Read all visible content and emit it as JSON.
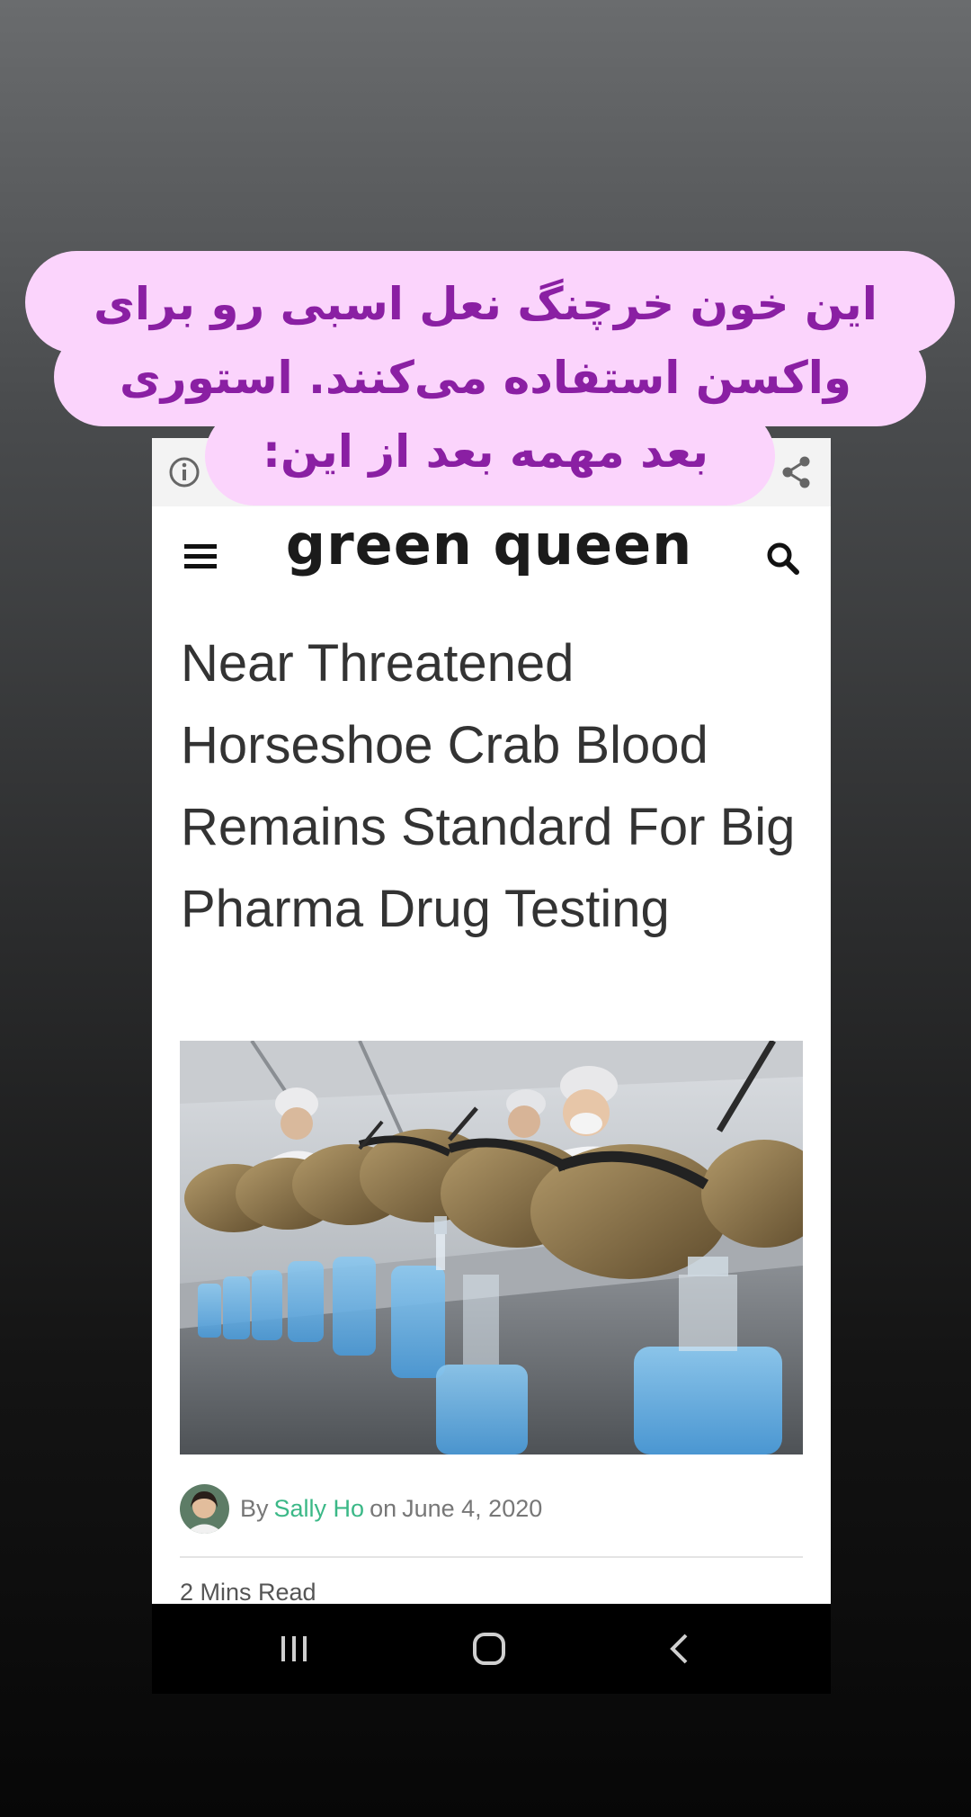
{
  "story_caption": {
    "lines": [
      "این خون خرچنگ نعل اسبی رو برای",
      "واکسن استفاده می‌کنند. استوری",
      "بعد مهمه بعد از این:"
    ],
    "bubble_color": "#fbd4fc",
    "text_color": "#8a1fa3"
  },
  "browser": {
    "info_icon": "info-icon",
    "share_icon": "share-icon"
  },
  "site": {
    "logo_text": "green queen",
    "menu_icon": "hamburger-menu-icon",
    "search_icon": "search-icon"
  },
  "article": {
    "headline": "Near Threatened Horseshoe Crab Blood Remains Standard For Big Pharma Drug Testing",
    "byline_prefix": "By",
    "author": "Sally Ho",
    "date_prefix": "on",
    "date": "June 4, 2020",
    "read_time": "2 Mins Read",
    "author_color": "#3bb887"
  },
  "nav": {
    "recents_icon": "recent-apps-icon",
    "home_icon": "home-icon",
    "back_icon": "back-icon"
  }
}
